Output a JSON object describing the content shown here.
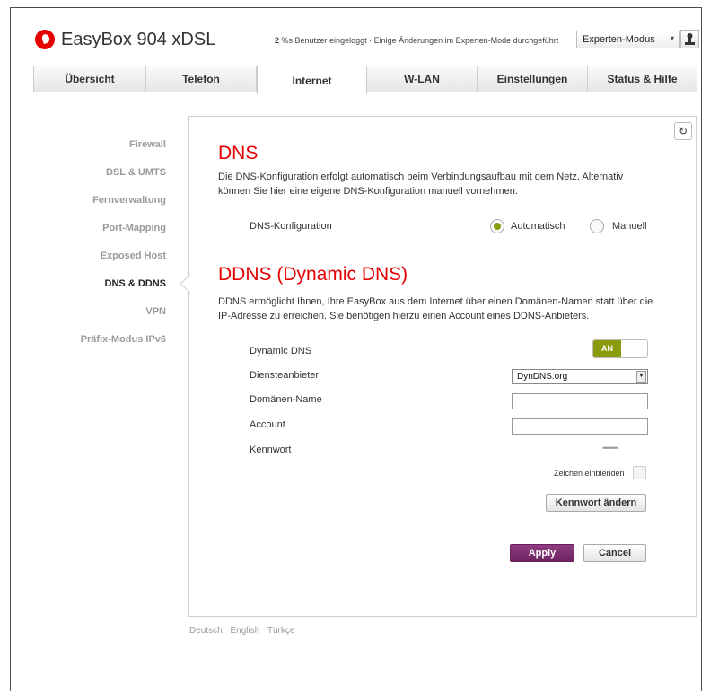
{
  "header": {
    "app_title": "EasyBox 904 xDSL",
    "status_count": "2",
    "status_text": "%s Benutzer eingeloggt · Einige Änderungen im Experten-Mode durchgeführt",
    "mode_select_value": "Experten-Modus",
    "user_icon": "user-icon"
  },
  "tabs": [
    {
      "label": "Übersicht",
      "active": false
    },
    {
      "label": "Telefon",
      "active": false
    },
    {
      "label": "Internet",
      "active": true
    },
    {
      "label": "W-LAN",
      "active": false
    },
    {
      "label": "Einstellungen",
      "active": false
    },
    {
      "label": "Status & Hilfe",
      "active": false
    }
  ],
  "sidebar": {
    "items": [
      {
        "label": "Firewall",
        "active": false
      },
      {
        "label": "DSL & UMTS",
        "active": false
      },
      {
        "label": "Fernverwaltung",
        "active": false
      },
      {
        "label": "Port-Mapping",
        "active": false
      },
      {
        "label": "Exposed Host",
        "active": false
      },
      {
        "label": "DNS & DDNS",
        "active": true
      },
      {
        "label": "VPN",
        "active": false
      },
      {
        "label": "Präfix-Modus IPv6",
        "active": false
      }
    ]
  },
  "dns": {
    "title": "DNS",
    "description_line1": "Die DNS-Konfiguration erfolgt automatisch beim Verbindungsaufbau mit dem Netz. Alternativ",
    "description_line2": "können Sie hier eine eigene DNS-Konfiguration manuell vornehmen.",
    "config_label": "DNS-Konfiguration",
    "option_auto": "Automatisch",
    "option_manual": "Manuell",
    "selected": "Automatisch"
  },
  "ddns": {
    "title": "DDNS (Dynamic DNS)",
    "description_line1": "DDNS ermöglicht Ihnen, Ihre EasyBox aus dem Internet über einen Domänen-Namen statt über die",
    "description_line2": "IP-Adresse zu erreichen. Sie benötigen hierzu einen Account eines DDNS-Anbieters.",
    "dynamic_dns_label": "Dynamic DNS",
    "toggle_label": "AN",
    "provider_label": "Diensteanbieter",
    "provider_value": "DynDNS.org",
    "domain_label": "Domänen-Name",
    "domain_value": "",
    "account_label": "Account",
    "account_value": "",
    "password_label": "Kennwort",
    "password_mask": "••••••••",
    "show_chars_label": "Zeichen einblenden",
    "change_password_button": "Kennwort ändern"
  },
  "actions": {
    "apply": "Apply",
    "cancel": "Cancel"
  },
  "footer": {
    "languages": [
      "Deutsch",
      "English",
      "Türkçe"
    ]
  },
  "colors": {
    "brand_red": "#e60000",
    "toggle_green": "#8a9b0e",
    "apply_purple": "#7a2a6c"
  }
}
